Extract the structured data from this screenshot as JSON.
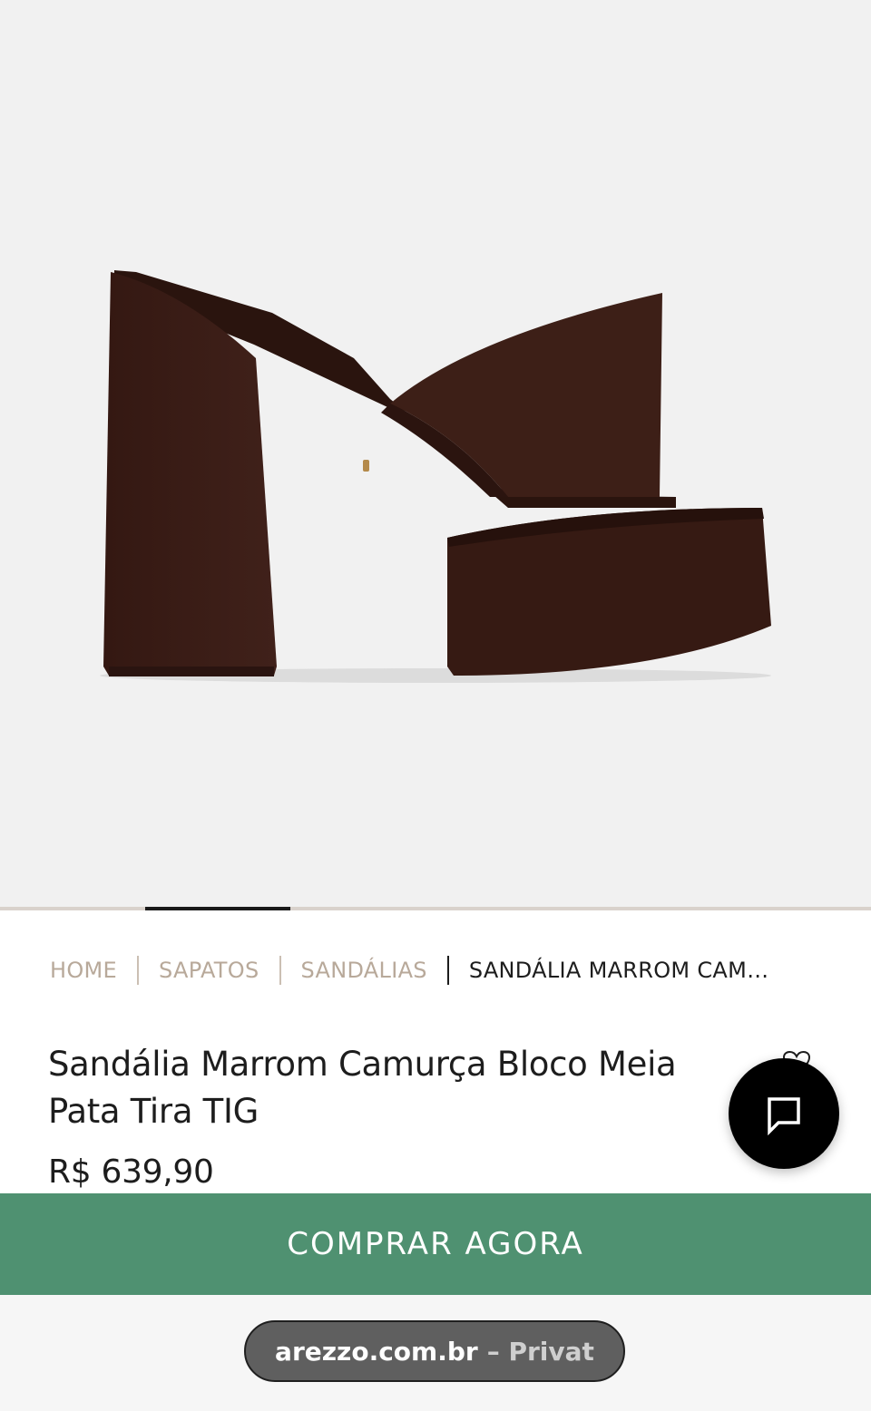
{
  "product_image": {
    "alt": "Sandália Marrom Camurça Bloco Meia Pata Tira TIG"
  },
  "gallery": {
    "active_index": 1,
    "count": 6
  },
  "breadcrumb": {
    "items": [
      "HOME",
      "SAPATOS",
      "SANDÁLIAS",
      "SANDÁLIA MARROM CAM…"
    ]
  },
  "product": {
    "title": "Sandália Marrom Camurça Bloco Meia Pata Tira TIG",
    "price": "R$ 639,90"
  },
  "actions": {
    "buy_label": "COMPRAR AGORA"
  },
  "browser": {
    "domain": "arezzo.com.br",
    "mode": "– Privat"
  },
  "colors": {
    "hero_bg": "#f1f1f1",
    "suede": "#3b1d14",
    "buy_button": "#4f9171",
    "breadcrumb_muted": "#b8a99a",
    "text": "#1d1d1d"
  },
  "icons": {
    "chat": "chat-bubble-icon",
    "wishlist": "heart-icon"
  }
}
